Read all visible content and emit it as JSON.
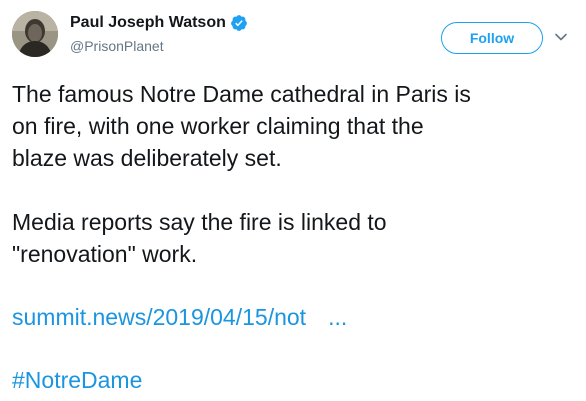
{
  "author": {
    "name": "Paul Joseph Watson",
    "handle": "@PrisonPlanet",
    "verified": true
  },
  "follow_button": {
    "label": "Follow"
  },
  "tweet": {
    "paragraph1_line1": "The famous Notre Dame cathedral in Paris is",
    "paragraph1_line2": "on fire, with one worker claiming that the",
    "paragraph1_line3": "blaze was deliberately set.",
    "paragraph2_line1": "Media reports say the fire is linked to",
    "paragraph2_line2": "\"renovation\" work.",
    "link": "summit.news/2019/04/15/not",
    "link_ellipsis": "...",
    "hashtag": "#NotreDame"
  },
  "icons": {
    "verified": "verified-badge-icon",
    "caret": "chevron-down-icon",
    "avatar": "avatar"
  },
  "colors": {
    "accent": "#1da1f2",
    "link": "#1b95e0",
    "text": "#14171a",
    "secondary": "#657786"
  }
}
